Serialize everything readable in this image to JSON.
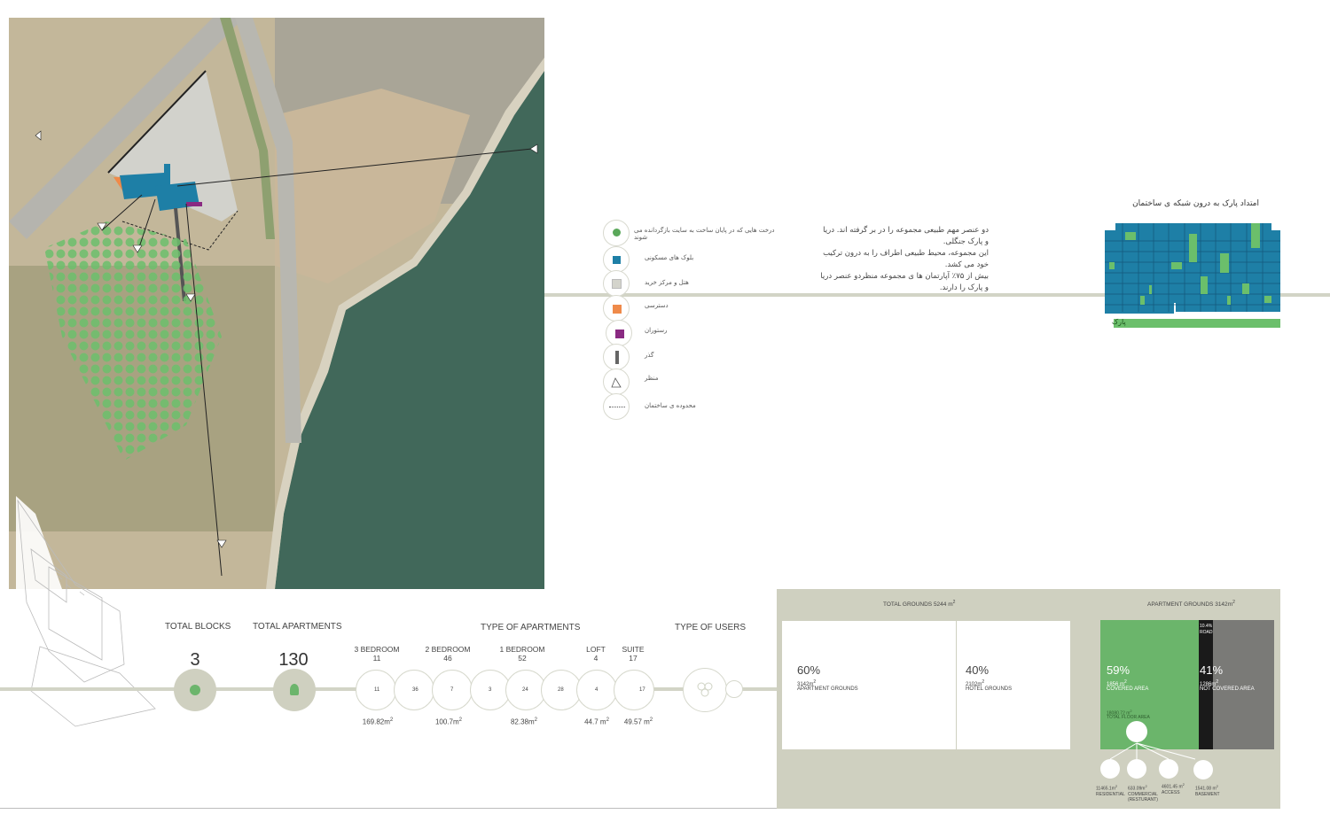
{
  "legend": {
    "items": [
      {
        "icon": "tree-icon",
        "label": "درخت هایی که در پایان ساخت به سایت بازگردانده می شوند",
        "color": "#5aa85a"
      },
      {
        "icon": "residential-block-icon",
        "label": "بلوک های مسکونی",
        "color": "#1e7fa6"
      },
      {
        "icon": "hotel-mall-icon",
        "label": "هتل و مرکز خرید",
        "color": "#d4d4cc"
      },
      {
        "icon": "access-icon",
        "label": "دسترسی",
        "color": "#ef8a4a"
      },
      {
        "icon": "restaurant-icon",
        "label": "رستوران",
        "color": "#8a2a82"
      },
      {
        "icon": "passage-icon",
        "label": "گذر",
        "color": "#666666"
      },
      {
        "icon": "view-icon",
        "label": "منظر",
        "color": "#555555"
      },
      {
        "icon": "boundary-icon",
        "label": "محدوده ی ساختمان",
        "color": "#555555"
      }
    ]
  },
  "description": {
    "lines": [
      "دو عنصر مهم طبیعی مجموعه را در بر گرفته اند. دریا",
      "و پارک جنگلی.",
      "این مجموعه، محیط طبیعی اطراف را به درون ترکیب",
      "خود می کشد.",
      "بیش از ۷۵٪ آپارتمان ها ی مجموعه منظردو عنصر دریا",
      "و پارک را دارند."
    ]
  },
  "park_grid": {
    "title": "امتداد پارک به درون شبکه ی ساختمان",
    "park_label": "پارک",
    "colors": {
      "building": "#1e7fa6",
      "park": "#6bbf6b"
    }
  },
  "stats": {
    "total_blocks_label": "TOTAL BLOCKS",
    "total_blocks_value": "3",
    "total_apartments_label": "TOTAL APARTMENTS",
    "total_apartments_value": "130",
    "type_of_apartments_label": "TYPE OF APARTMENTS",
    "type_of_users_label": "TYPE OF USERS"
  },
  "apartment_types": [
    {
      "name": "3 BEDROOM",
      "count": "11",
      "area": "169.82m"
    },
    {
      "name": "2 BEDROOM",
      "count": "46",
      "area": "100.7m"
    },
    {
      "name": "1 BEDROOM",
      "count": "52",
      "area": "82.38m"
    },
    {
      "name": "LOFT",
      "count": "4",
      "area": "44.7 m"
    },
    {
      "name": "SUITE",
      "count": "17",
      "area": "49.57  m"
    }
  ],
  "apartment_circle_counts": [
    "11",
    "36",
    "7",
    "3",
    "24",
    "28",
    "4",
    "17"
  ],
  "grounds": {
    "total_title": "TOTAL GROUNDS 5244 m",
    "apartment_title": "APARTMENT GROUNDS 3142m",
    "apartment_pct": "60%",
    "apartment_area": "3142m",
    "apartment_label": "APARTMENT GROUNDS",
    "hotel_pct": "40%",
    "hotel_area": "2102m",
    "hotel_label": "HOTEL GROUNDS",
    "covered_pct": "59%",
    "covered_area": "1856 m",
    "covered_label": "COVERED AREA",
    "not_covered_pct": "41%",
    "not_covered_area": "1286m",
    "not_covered_label": "NOT COVERED AREA",
    "roads_pct": "10.4%",
    "roads_label": "ROADS",
    "total_floor_area_value": "18080.72 m",
    "total_floor_area_label": "TOTAL FLOOR AREA",
    "breakdown": [
      {
        "value": "11465.1m",
        "label": "RESIDENTIAL"
      },
      {
        "value": "633.09m",
        "label": "COMMERCIAL (RESTURANT)"
      },
      {
        "value": "4601.45 m",
        "label": "ACCESS"
      },
      {
        "value": "1541.08 m",
        "label": "BASEMENT"
      }
    ],
    "colors": {
      "panel": "#cfd0c0",
      "covered": "#6bb56b",
      "roads": "#1a1a1a",
      "not_covered": "#7a7a77"
    }
  },
  "superscript": "2"
}
